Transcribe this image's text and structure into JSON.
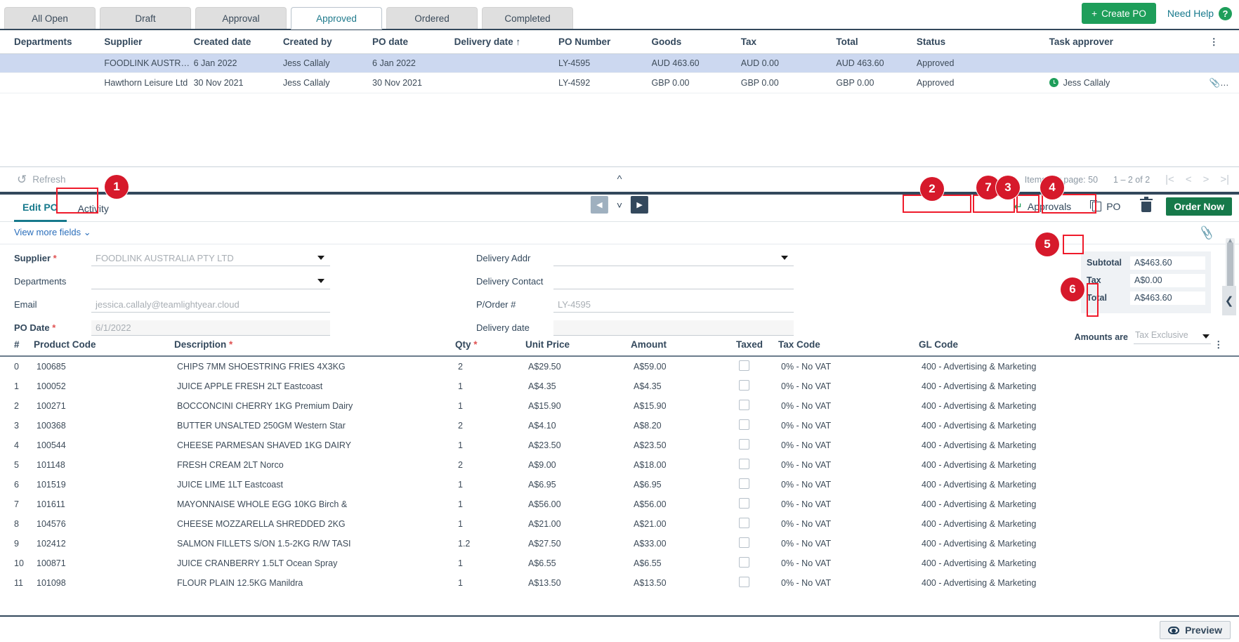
{
  "header": {
    "tabs": [
      {
        "label": "All Open",
        "active": false
      },
      {
        "label": "Draft",
        "active": false
      },
      {
        "label": "Approval",
        "active": false
      },
      {
        "label": "Approved",
        "active": true
      },
      {
        "label": "Ordered",
        "active": false
      },
      {
        "label": "Completed",
        "active": false
      }
    ],
    "create_po_label": "Create PO",
    "create_po_plus": "+",
    "need_help_label": "Need Help",
    "help_glyph": "?",
    "create_po_color": "#1e9e5a"
  },
  "grid": {
    "columns": [
      "Departments",
      "Supplier",
      "Created date",
      "Created by",
      "PO date",
      "Delivery date ↑",
      "PO Number",
      "Goods",
      "Tax",
      "Total",
      "Status",
      "Task approver"
    ],
    "rows": [
      {
        "departments": "",
        "supplier": "FOODLINK AUSTRALIA…",
        "created_date": "6 Jan 2022",
        "created_by": "Jess Callaly",
        "po_date": "6 Jan 2022",
        "delivery_date": "",
        "po_number": "LY-4595",
        "goods": "AUD 463.60",
        "tax": "AUD 0.00",
        "total": "AUD 463.60",
        "status": "Approved",
        "task_approver": "",
        "selected": true
      },
      {
        "departments": "",
        "supplier": "Hawthorn Leisure Ltd",
        "created_date": "30 Nov 2021",
        "created_by": "Jess Callaly",
        "po_date": "30 Nov 2021",
        "delivery_date": "",
        "po_number": "LY-4592",
        "goods": "GBP 0.00",
        "tax": "GBP 0.00",
        "total": "GBP 0.00",
        "status": "Approved",
        "task_approver": "Jess Callaly",
        "selected": false
      }
    ]
  },
  "toolbar": {
    "refresh_label": "Refresh",
    "items_per_page_label": "Items per page: 50",
    "range_label": "1 – 2 of 2",
    "first_page": "|<",
    "prev_page": "<",
    "next_page": ">",
    "last_page": ">|"
  },
  "detail": {
    "tabs": [
      {
        "label": "Edit PO",
        "active": true
      },
      {
        "label": "Activity",
        "active": false
      }
    ],
    "actions": {
      "approvals_label": "Approvals",
      "approvals_icon": "↵",
      "po_label": "PO",
      "delete_label": "",
      "order_now_label": "Order Now",
      "order_now_color": "#16794a"
    },
    "view_more_fields": "View more fields",
    "attach_icon": "📎",
    "form_left": [
      {
        "label": "Supplier",
        "required": true,
        "bold": true,
        "value": "FOODLINK AUSTRALIA PTY LTD",
        "dropdown": true,
        "shaded": false
      },
      {
        "label": "Departments",
        "required": false,
        "bold": false,
        "value": "",
        "dropdown": true,
        "shaded": false
      },
      {
        "label": "Email",
        "required": false,
        "bold": false,
        "value": "jessica.callaly@teamlightyear.cloud",
        "dropdown": false,
        "shaded": false
      },
      {
        "label": "PO Date",
        "required": true,
        "bold": true,
        "value": "6/1/2022",
        "dropdown": false,
        "shaded": true
      }
    ],
    "form_mid": [
      {
        "label": "Delivery Addr",
        "required": false,
        "bold": false,
        "value": "",
        "dropdown": true,
        "shaded": false
      },
      {
        "label": "Delivery Contact",
        "required": false,
        "bold": false,
        "value": "",
        "dropdown": false,
        "shaded": false
      },
      {
        "label": "P/Order #",
        "required": false,
        "bold": false,
        "value": "LY-4595",
        "dropdown": false,
        "shaded": false
      },
      {
        "label": "Delivery date",
        "required": false,
        "bold": false,
        "value": "",
        "dropdown": false,
        "shaded": true
      }
    ],
    "totals": [
      {
        "label": "Subtotal",
        "value": "A$463.60"
      },
      {
        "label": "Tax",
        "value": "A$0.00"
      },
      {
        "label": "Total",
        "value": "A$463.60"
      }
    ],
    "amounts_are_label": "Amounts are",
    "amounts_are_value": "Tax Exclusive"
  },
  "lines": {
    "columns": [
      "#",
      "Product Code",
      "Description *",
      "Qty *",
      "Unit Price",
      "Amount",
      "Taxed",
      "Tax Code",
      "GL Code"
    ],
    "rows": [
      {
        "idx": "0",
        "code": "100685",
        "desc": "CHIPS 7MM SHOESTRING FRIES 4X3KG",
        "qty": "2",
        "price": "A$29.50",
        "amount": "A$59.00",
        "tax_code": "0% - No VAT",
        "gl": "400 - Advertising & Marketing"
      },
      {
        "idx": "1",
        "code": "100052",
        "desc": "JUICE APPLE FRESH 2LT Eastcoast",
        "qty": "1",
        "price": "A$4.35",
        "amount": "A$4.35",
        "tax_code": "0% - No VAT",
        "gl": "400 - Advertising & Marketing"
      },
      {
        "idx": "2",
        "code": "100271",
        "desc": "BOCCONCINI CHERRY 1KG Premium Dairy",
        "qty": "1",
        "price": "A$15.90",
        "amount": "A$15.90",
        "tax_code": "0% - No VAT",
        "gl": "400 - Advertising & Marketing"
      },
      {
        "idx": "3",
        "code": "100368",
        "desc": "BUTTER UNSALTED 250GM Western Star",
        "qty": "2",
        "price": "A$4.10",
        "amount": "A$8.20",
        "tax_code": "0% - No VAT",
        "gl": "400 - Advertising & Marketing"
      },
      {
        "idx": "4",
        "code": "100544",
        "desc": "CHEESE PARMESAN SHAVED 1KG DAIRY",
        "qty": "1",
        "price": "A$23.50",
        "amount": "A$23.50",
        "tax_code": "0% - No VAT",
        "gl": "400 - Advertising & Marketing"
      },
      {
        "idx": "5",
        "code": "101148",
        "desc": "FRESH CREAM 2LT Norco",
        "qty": "2",
        "price": "A$9.00",
        "amount": "A$18.00",
        "tax_code": "0% - No VAT",
        "gl": "400 - Advertising & Marketing"
      },
      {
        "idx": "6",
        "code": "101519",
        "desc": "JUICE LIME 1LT Eastcoast",
        "qty": "1",
        "price": "A$6.95",
        "amount": "A$6.95",
        "tax_code": "0% - No VAT",
        "gl": "400 - Advertising & Marketing"
      },
      {
        "idx": "7",
        "code": "101611",
        "desc": "MAYONNAISE WHOLE EGG 10KG Birch &",
        "qty": "1",
        "price": "A$56.00",
        "amount": "A$56.00",
        "tax_code": "0% - No VAT",
        "gl": "400 - Advertising & Marketing"
      },
      {
        "idx": "8",
        "code": "104576",
        "desc": "CHEESE MOZZARELLA SHREDDED 2KG",
        "qty": "1",
        "price": "A$21.00",
        "amount": "A$21.00",
        "tax_code": "0% - No VAT",
        "gl": "400 - Advertising & Marketing"
      },
      {
        "idx": "9",
        "code": "102412",
        "desc": "SALMON FILLETS S/ON 1.5-2KG R/W TASI",
        "qty": "1.2",
        "price": "A$27.50",
        "amount": "A$33.00",
        "tax_code": "0% - No VAT",
        "gl": "400 - Advertising & Marketing"
      },
      {
        "idx": "10",
        "code": "100871",
        "desc": "JUICE CRANBERRY 1.5LT Ocean Spray",
        "qty": "1",
        "price": "A$6.55",
        "amount": "A$6.55",
        "tax_code": "0% - No VAT",
        "gl": "400 - Advertising & Marketing"
      },
      {
        "idx": "11",
        "code": "101098",
        "desc": "FLOUR PLAIN 12.5KG Manildra",
        "qty": "1",
        "price": "A$13.50",
        "amount": "A$13.50",
        "tax_code": "0% - No VAT",
        "gl": "400 - Advertising & Marketing"
      }
    ]
  },
  "footer": {
    "preview_label": "Preview"
  },
  "callouts": [
    {
      "n": "1"
    },
    {
      "n": "2"
    },
    {
      "n": "3"
    },
    {
      "n": "4"
    },
    {
      "n": "5"
    },
    {
      "n": "6"
    },
    {
      "n": "7"
    }
  ]
}
